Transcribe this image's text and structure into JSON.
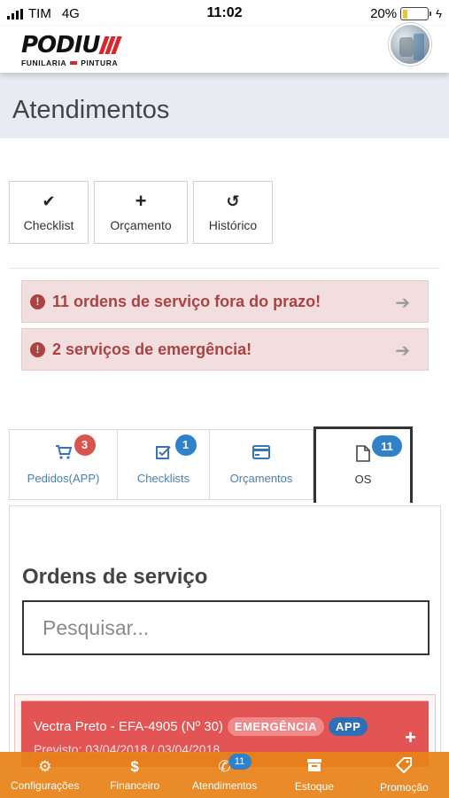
{
  "status_bar": {
    "carrier": "TIM",
    "network": "4G",
    "time": "11:02",
    "battery": "20%",
    "battery_level": 0.2
  },
  "header": {
    "logo_text": "PODIU",
    "logo_subtitle_left": "FUNILARIA",
    "logo_subtitle_right": "PINTURA",
    "brand_color": "#d8262b"
  },
  "page": {
    "title": "Atendimentos"
  },
  "actions": {
    "checklist": {
      "label": "Checklist",
      "icon": "check-icon"
    },
    "orcamento": {
      "label": "Orçamento",
      "icon": "plus-icon"
    },
    "historico": {
      "label": "Histórico",
      "icon": "history-icon"
    }
  },
  "alerts": [
    {
      "text": "11 ordens de serviço fora do prazo!",
      "icon": "exclamation-circle-icon"
    },
    {
      "text": "2 serviços de emergência!",
      "icon": "exclamation-circle-icon"
    }
  ],
  "tabs": [
    {
      "label": "Pedidos(APP)",
      "badge": "3",
      "icon": "cart-icon"
    },
    {
      "label": "Checklists",
      "badge": "1",
      "icon": "checkbox-icon"
    },
    {
      "label": "Orçamentos",
      "icon": "credit-card-icon"
    },
    {
      "label": "OS",
      "badge": "11",
      "icon": "file-icon",
      "active": true
    }
  ],
  "orders": {
    "title": "Ordens de serviço",
    "search_placeholder": "Pesquisar...",
    "items": [
      {
        "title": "Vectra Preto - EFA-4905 (Nº 30)",
        "tag_emergency": "EMERGÊNCIA",
        "tag_app": "APP",
        "dates": "Previsto: 03/04/2018 / 03/04/2018"
      }
    ]
  },
  "bottom_nav": [
    {
      "label": "Configurações",
      "icon": "gears-icon"
    },
    {
      "label": "Financeiro",
      "icon": "dollar-icon"
    },
    {
      "label": "Atendimentos",
      "icon": "phone-icon",
      "badge": "11"
    },
    {
      "label": "Estoque",
      "icon": "archive-icon"
    },
    {
      "label": "Promoção",
      "icon": "tag-icon"
    }
  ],
  "colors": {
    "accent_orange": "#e78218",
    "alert_bg": "#f2dede",
    "alert_text": "#a94442",
    "badge_blue": "#2f82c9",
    "badge_red": "#d9534f",
    "card_red": "#e35454"
  }
}
